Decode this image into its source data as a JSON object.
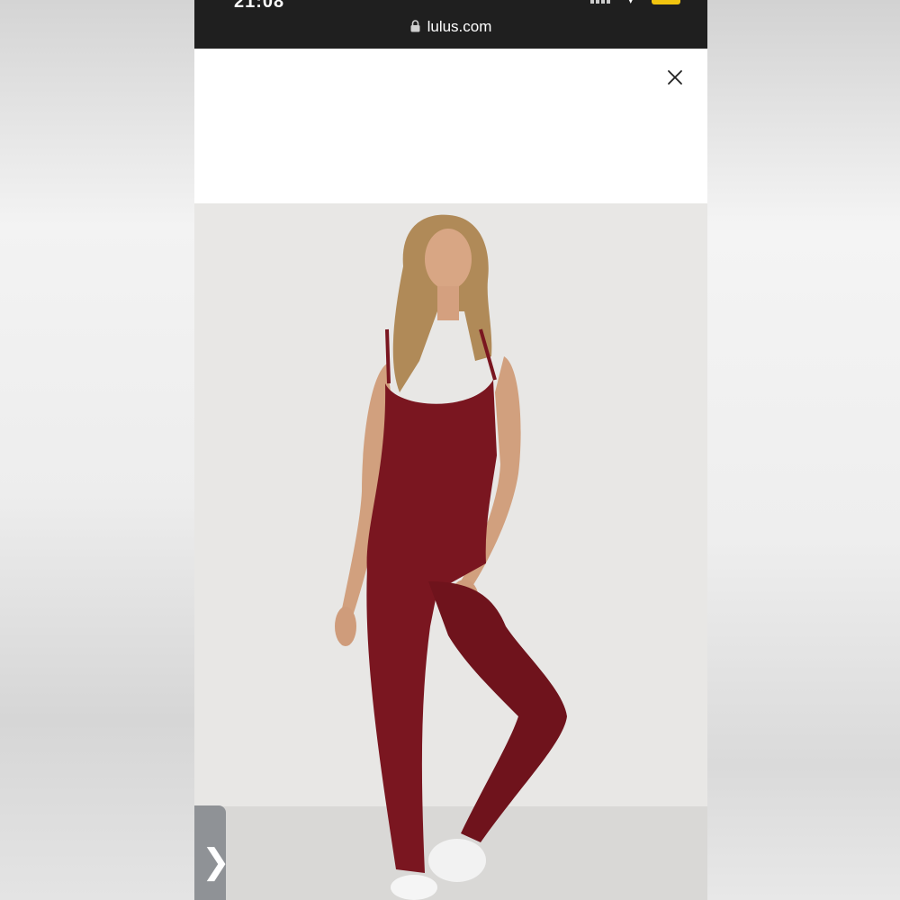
{
  "status_bar": {
    "time": "21:08",
    "battery_color": "#f1c40f"
  },
  "browser": {
    "url": "lulus.com",
    "lock_icon": "lock-icon",
    "bar_color": "#1f1f1f"
  },
  "modal": {
    "close_icon": "close-icon"
  },
  "product": {
    "image_icon": "model-jumpsuit-photo",
    "garment_color": "#7a1620",
    "background_color": "#e8e7e5"
  },
  "carousel": {
    "next_symbol": "❯",
    "next_icon": "chevron-right-icon"
  }
}
